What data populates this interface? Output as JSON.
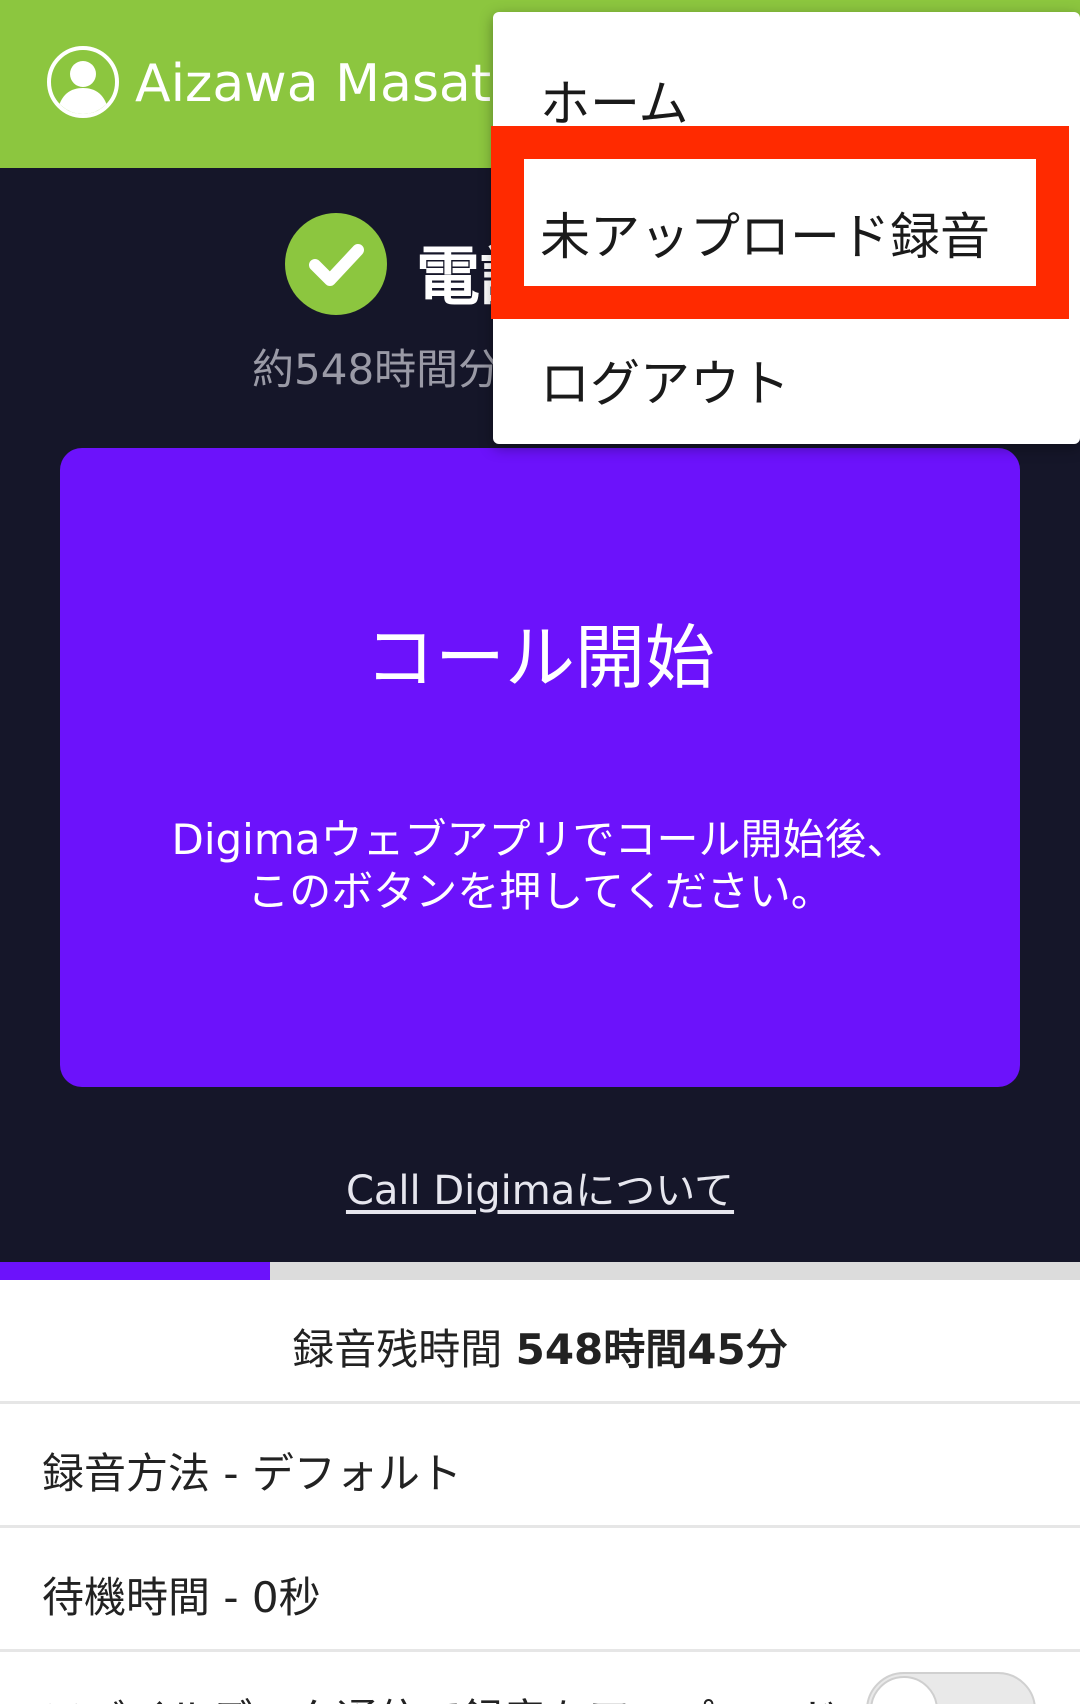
{
  "header": {
    "user_name": "Aizawa Masato",
    "bg_color": "#8cc63f"
  },
  "status": {
    "title_partial": "電話",
    "remaining_partial": "約548時間分"
  },
  "call_button": {
    "title": "コール開始",
    "subtitle_line1": "Digimaウェブアプリでコール開始後、",
    "subtitle_line2": "このボタンを押してください。",
    "color": "#6c12fb"
  },
  "about_link": "Call Digimaについて",
  "progress": {
    "fraction": 0.25
  },
  "info": {
    "remaining_label": "録音残時間 ",
    "remaining_value": "548時間45分",
    "method": "録音方法 - デフォルト",
    "wait": "待機時間 - 0秒",
    "mobile_data": "モバイルデータ通信で録音をアップロード"
  },
  "menu": {
    "items": [
      {
        "label": "ホーム"
      },
      {
        "label": "未アップロード録音"
      },
      {
        "label": "ログアウト"
      }
    ],
    "highlight_color": "#ff2a00"
  },
  "icons": {
    "avatar": "person-icon",
    "check": "check-icon"
  }
}
